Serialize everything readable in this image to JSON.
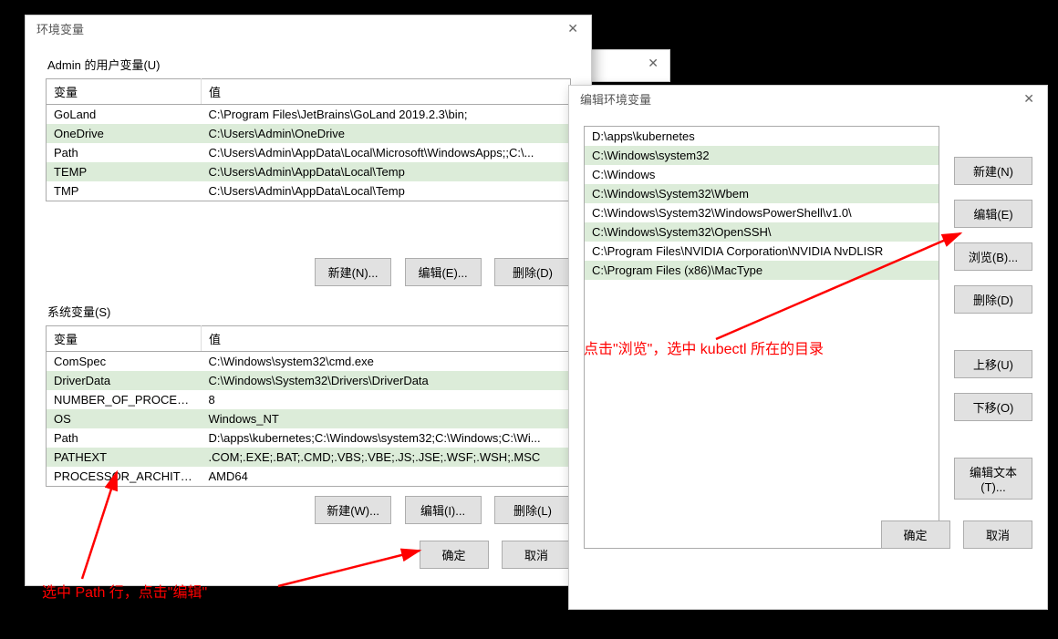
{
  "env_dialog": {
    "title": "环境变量",
    "user_section_label": "Admin 的用户变量(U)",
    "sys_section_label": "系统变量(S)",
    "col_variable": "变量",
    "col_value": "值",
    "user_vars": [
      {
        "name": "GoLand",
        "value": "C:\\Program Files\\JetBrains\\GoLand 2019.2.3\\bin;"
      },
      {
        "name": "OneDrive",
        "value": "C:\\Users\\Admin\\OneDrive"
      },
      {
        "name": "Path",
        "value": "C:\\Users\\Admin\\AppData\\Local\\Microsoft\\WindowsApps;;C:\\..."
      },
      {
        "name": "TEMP",
        "value": "C:\\Users\\Admin\\AppData\\Local\\Temp"
      },
      {
        "name": "TMP",
        "value": "C:\\Users\\Admin\\AppData\\Local\\Temp"
      }
    ],
    "sys_vars": [
      {
        "name": "ComSpec",
        "value": "C:\\Windows\\system32\\cmd.exe"
      },
      {
        "name": "DriverData",
        "value": "C:\\Windows\\System32\\Drivers\\DriverData"
      },
      {
        "name": "NUMBER_OF_PROCESSORS",
        "value": "8"
      },
      {
        "name": "OS",
        "value": "Windows_NT"
      },
      {
        "name": "Path",
        "value": "D:\\apps\\kubernetes;C:\\Windows\\system32;C:\\Windows;C:\\Wi..."
      },
      {
        "name": "PATHEXT",
        "value": ".COM;.EXE;.BAT;.CMD;.VBS;.VBE;.JS;.JSE;.WSF;.WSH;.MSC"
      },
      {
        "name": "PROCESSOR_ARCHITECT...",
        "value": "AMD64"
      }
    ],
    "buttons": {
      "new_user": "新建(N)...",
      "edit_user": "编辑(E)...",
      "delete_user": "删除(D)",
      "new_sys": "新建(W)...",
      "edit_sys": "编辑(I)...",
      "delete_sys": "删除(L)",
      "ok": "确定",
      "cancel": "取消"
    }
  },
  "edit_dialog": {
    "title": "编辑环境变量",
    "entries": [
      "D:\\apps\\kubernetes",
      "C:\\Windows\\system32",
      "C:\\Windows",
      "C:\\Windows\\System32\\Wbem",
      "C:\\Windows\\System32\\WindowsPowerShell\\v1.0\\",
      "C:\\Windows\\System32\\OpenSSH\\",
      "C:\\Program Files\\NVIDIA Corporation\\NVIDIA NvDLISR",
      "C:\\Program Files (x86)\\MacType"
    ],
    "buttons": {
      "new": "新建(N)",
      "edit": "编辑(E)",
      "browse": "浏览(B)...",
      "delete": "删除(D)",
      "moveup": "上移(U)",
      "movedown": "下移(O)",
      "edittext": "编辑文本(T)...",
      "ok": "确定",
      "cancel": "取消"
    }
  },
  "annotations": {
    "left": "选中 Path 行，点击\"编辑\"",
    "right": "点击\"浏览\"，选中 kubectl 所在的目录"
  }
}
